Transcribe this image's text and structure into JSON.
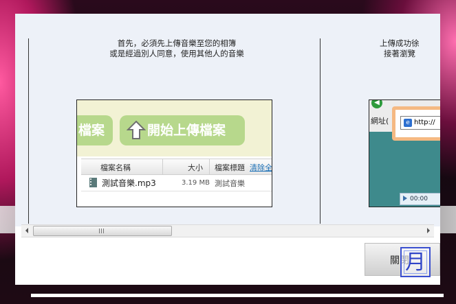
{
  "step1": {
    "caption_line1": "首先，必須先上傳音樂至您的相簿",
    "caption_line2": "或是經過別人同意，使用其他人的音樂",
    "upload_button_partial": "檔案",
    "upload_button": "開始上傳檔案",
    "table": {
      "headers": [
        "檔案名稱",
        "大小",
        "檔案標題",
        "清除全"
      ],
      "rows": [
        {
          "name": "測試音樂.mp3",
          "size": "3.19 MB",
          "title": "測試音樂"
        }
      ]
    }
  },
  "step2": {
    "caption_line1": "上傳成功徐",
    "caption_line2": "接著瀏覽",
    "address_label": "網址(",
    "address_text": "http://",
    "player_time": "00:00"
  },
  "scrollbar": {
    "grip": "|||"
  },
  "close_button": {
    "label": "關閉"
  },
  "ime_indicator": {
    "char": "月"
  },
  "colors": {
    "panel_bg": "#edf1f8",
    "pill_green": "#b7d88c",
    "address_highlight": "#f5b982"
  }
}
